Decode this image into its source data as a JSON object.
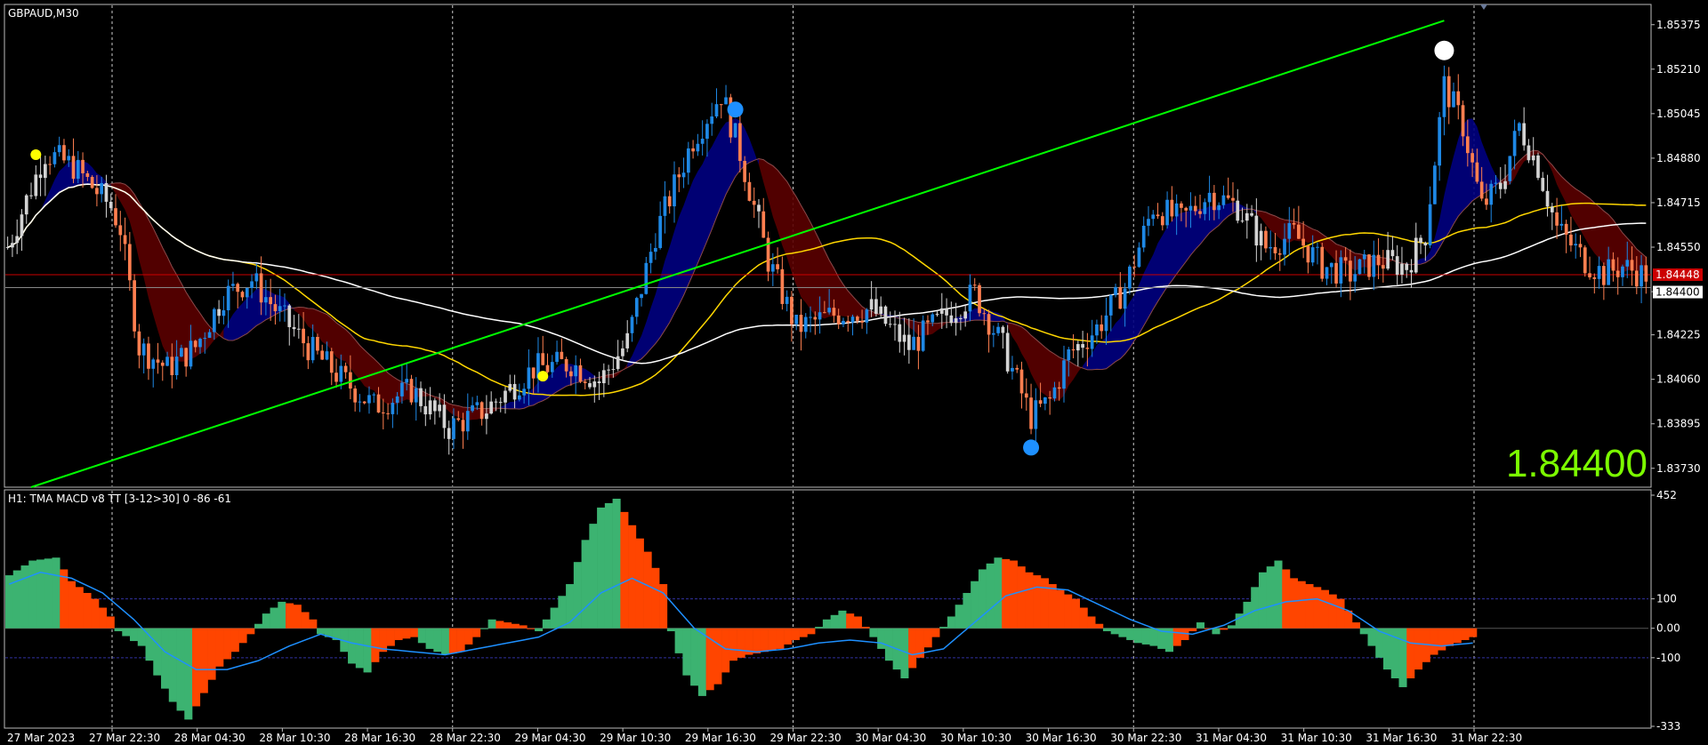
{
  "chart_data": {
    "type": "candlestick",
    "symbol_label": "GBPAUD,M30",
    "big_price": "1.84400",
    "price_axis": {
      "ticks": [
        "1.85375",
        "1.85210",
        "1.85045",
        "1.84880",
        "1.84715",
        "1.84550",
        "1.84385",
        "1.84225",
        "1.84060",
        "1.83895",
        "1.83730"
      ],
      "ylim": [
        1.8366,
        1.8545
      ],
      "bid_tag": "1.84448",
      "ask_tag": "1.84400",
      "bid": 1.84448,
      "ask": 1.844
    },
    "time_axis": {
      "labels": [
        "27 Mar 2023",
        "27 Mar 22:30",
        "28 Mar 04:30",
        "28 Mar 10:30",
        "28 Mar 16:30",
        "28 Mar 22:30",
        "29 Mar 04:30",
        "29 Mar 10:30",
        "29 Mar 16:30",
        "29 Mar 22:30",
        "30 Mar 04:30",
        "30 Mar 10:30",
        "30 Mar 16:30",
        "30 Mar 22:30",
        "31 Mar 04:30",
        "31 Mar 10:30",
        "31 Mar 16:30",
        "31 Mar 22:30"
      ],
      "gridlines_at": [
        "27 Mar 22:30",
        "28 Mar 22:30",
        "29 Mar 22:30",
        "30 Mar 22:30",
        "31 Mar 22:30"
      ]
    },
    "close_keypoints": [
      [
        0,
        1.8455
      ],
      [
        8,
        1.849
      ],
      [
        14,
        1.8485
      ],
      [
        22,
        1.847
      ],
      [
        24,
        1.8462
      ],
      [
        28,
        1.8418
      ],
      [
        34,
        1.841
      ],
      [
        40,
        1.8418
      ],
      [
        46,
        1.8437
      ],
      [
        52,
        1.8443
      ],
      [
        58,
        1.843
      ],
      [
        64,
        1.8418
      ],
      [
        70,
        1.8408
      ],
      [
        78,
        1.8396
      ],
      [
        86,
        1.8402
      ],
      [
        94,
        1.8388
      ],
      [
        102,
        1.8395
      ],
      [
        112,
        1.841
      ],
      [
        120,
        1.8412
      ],
      [
        126,
        1.8405
      ],
      [
        132,
        1.842
      ],
      [
        138,
        1.846
      ],
      [
        146,
        1.8495
      ],
      [
        152,
        1.8512
      ],
      [
        156,
        1.849
      ],
      [
        162,
        1.845
      ],
      [
        168,
        1.8425
      ],
      [
        176,
        1.843
      ],
      [
        184,
        1.8432
      ],
      [
        192,
        1.8418
      ],
      [
        200,
        1.843
      ],
      [
        206,
        1.8438
      ],
      [
        212,
        1.8418
      ],
      [
        218,
        1.8392
      ],
      [
        222,
        1.8398
      ],
      [
        226,
        1.8415
      ],
      [
        232,
        1.8425
      ],
      [
        238,
        1.844
      ],
      [
        244,
        1.847
      ],
      [
        250,
        1.8465
      ],
      [
        256,
        1.8475
      ],
      [
        262,
        1.847
      ],
      [
        268,
        1.8455
      ],
      [
        274,
        1.846
      ],
      [
        280,
        1.8448
      ],
      [
        286,
        1.8445
      ],
      [
        292,
        1.845
      ],
      [
        298,
        1.8448
      ],
      [
        302,
        1.846
      ],
      [
        306,
        1.8515
      ],
      [
        310,
        1.85
      ],
      [
        314,
        1.847
      ],
      [
        318,
        1.8478
      ],
      [
        322,
        1.85
      ],
      [
        326,
        1.8485
      ],
      [
        330,
        1.8462
      ],
      [
        336,
        1.845
      ],
      [
        340,
        1.8445
      ],
      [
        344,
        1.8448
      ],
      [
        348,
        1.8445
      ]
    ],
    "series": [
      {
        "name": "TMA MACD v8 TT"
      }
    ],
    "markers": [
      {
        "color": "#ffff00",
        "at": 6,
        "side": "above"
      },
      {
        "color": "#ffff00",
        "at": 114,
        "side": "below"
      },
      {
        "color": "#1e90ff",
        "at": 155,
        "side": "above"
      },
      {
        "color": "#1e90ff",
        "at": 218,
        "side": "below"
      },
      {
        "color": "#ffffff",
        "at": 306,
        "side": "above"
      }
    ],
    "trendline": {
      "color": "#00ff00",
      "from": [
        5,
        1.8366
      ],
      "to": [
        306,
        1.8539
      ]
    },
    "indicator": {
      "label": "H1: TMA MACD v8 TT [3-12>30] 0 -86 -61",
      "ticks": [
        "452",
        "100",
        "0.00",
        "-100",
        "-333"
      ],
      "ylim": [
        -333,
        452
      ],
      "levels": [
        100,
        0,
        -100
      ],
      "histogram_keypoints": [
        [
          0,
          180
        ],
        [
          3,
          230
        ],
        [
          6,
          240
        ],
        [
          8,
          160
        ],
        [
          11,
          100
        ],
        [
          13,
          40
        ],
        [
          14,
          -10
        ],
        [
          17,
          -60
        ],
        [
          19,
          -160
        ],
        [
          21,
          -250
        ],
        [
          23,
          -310
        ],
        [
          25,
          -220
        ],
        [
          27,
          -130
        ],
        [
          29,
          -80
        ],
        [
          31,
          -20
        ],
        [
          33,
          50
        ],
        [
          35,
          90
        ],
        [
          37,
          80
        ],
        [
          39,
          30
        ],
        [
          40,
          -20
        ],
        [
          42,
          -40
        ],
        [
          44,
          -120
        ],
        [
          46,
          -150
        ],
        [
          48,
          -80
        ],
        [
          50,
          -40
        ],
        [
          52,
          -30
        ],
        [
          54,
          -70
        ],
        [
          56,
          -90
        ],
        [
          58,
          -80
        ],
        [
          60,
          -30
        ],
        [
          62,
          30
        ],
        [
          64,
          20
        ],
        [
          66,
          10
        ],
        [
          68,
          -10
        ],
        [
          70,
          70
        ],
        [
          72,
          150
        ],
        [
          74,
          300
        ],
        [
          76,
          410
        ],
        [
          78,
          440
        ],
        [
          80,
          350
        ],
        [
          82,
          260
        ],
        [
          84,
          150
        ],
        [
          85,
          -10
        ],
        [
          87,
          -160
        ],
        [
          89,
          -230
        ],
        [
          91,
          -190
        ],
        [
          93,
          -110
        ],
        [
          95,
          -90
        ],
        [
          97,
          -80
        ],
        [
          99,
          -70
        ],
        [
          101,
          -40
        ],
        [
          103,
          -20
        ],
        [
          105,
          30
        ],
        [
          107,
          60
        ],
        [
          109,
          40
        ],
        [
          111,
          -30
        ],
        [
          113,
          -110
        ],
        [
          115,
          -170
        ],
        [
          117,
          -100
        ],
        [
          119,
          -30
        ],
        [
          121,
          40
        ],
        [
          123,
          120
        ],
        [
          125,
          200
        ],
        [
          127,
          240
        ],
        [
          129,
          230
        ],
        [
          131,
          190
        ],
        [
          133,
          170
        ],
        [
          135,
          130
        ],
        [
          137,
          100
        ],
        [
          139,
          40
        ],
        [
          141,
          -10
        ],
        [
          143,
          -30
        ],
        [
          145,
          -50
        ],
        [
          147,
          -60
        ],
        [
          149,
          -80
        ],
        [
          151,
          -40
        ],
        [
          153,
          20
        ],
        [
          155,
          -20
        ],
        [
          157,
          10
        ],
        [
          159,
          90
        ],
        [
          161,
          190
        ],
        [
          163,
          230
        ],
        [
          165,
          170
        ],
        [
          167,
          150
        ],
        [
          169,
          130
        ],
        [
          171,
          100
        ],
        [
          173,
          20
        ],
        [
          175,
          -60
        ],
        [
          177,
          -140
        ],
        [
          179,
          -200
        ],
        [
          181,
          -140
        ],
        [
          183,
          -90
        ],
        [
          185,
          -60
        ],
        [
          187,
          -40
        ],
        [
          188,
          -30
        ]
      ],
      "signal_keypoints": [
        [
          0,
          150
        ],
        [
          4,
          190
        ],
        [
          8,
          170
        ],
        [
          12,
          120
        ],
        [
          16,
          30
        ],
        [
          20,
          -80
        ],
        [
          24,
          -140
        ],
        [
          28,
          -140
        ],
        [
          32,
          -110
        ],
        [
          36,
          -60
        ],
        [
          40,
          -20
        ],
        [
          44,
          -50
        ],
        [
          48,
          -70
        ],
        [
          52,
          -80
        ],
        [
          56,
          -90
        ],
        [
          60,
          -70
        ],
        [
          64,
          -50
        ],
        [
          68,
          -30
        ],
        [
          72,
          20
        ],
        [
          76,
          120
        ],
        [
          80,
          170
        ],
        [
          84,
          120
        ],
        [
          88,
          0
        ],
        [
          92,
          -70
        ],
        [
          96,
          -80
        ],
        [
          100,
          -70
        ],
        [
          104,
          -50
        ],
        [
          108,
          -40
        ],
        [
          112,
          -50
        ],
        [
          116,
          -90
        ],
        [
          120,
          -70
        ],
        [
          124,
          20
        ],
        [
          128,
          110
        ],
        [
          132,
          140
        ],
        [
          136,
          130
        ],
        [
          140,
          80
        ],
        [
          144,
          30
        ],
        [
          148,
          -10
        ],
        [
          152,
          -20
        ],
        [
          156,
          10
        ],
        [
          160,
          60
        ],
        [
          164,
          90
        ],
        [
          168,
          100
        ],
        [
          172,
          60
        ],
        [
          176,
          -10
        ],
        [
          180,
          -50
        ],
        [
          184,
          -60
        ],
        [
          188,
          -50
        ]
      ]
    },
    "colors": {
      "bull_candle": "#1e88e5",
      "bear_candle": "#ff7f50",
      "neutral_candle": "#d3d3d3",
      "tma_bull_fill": "#000080",
      "tma_bear_fill": "#5a0000",
      "ma_fast": "#ffd700",
      "ma_slow": "#ffffff",
      "bid_line": "#cc0000",
      "hist_up": "#3cb371",
      "hist_down": "#ff4500",
      "signal_line": "#1e90ff",
      "level_line": "#3232a0",
      "grid": "#ffffff"
    },
    "grid": "on"
  }
}
